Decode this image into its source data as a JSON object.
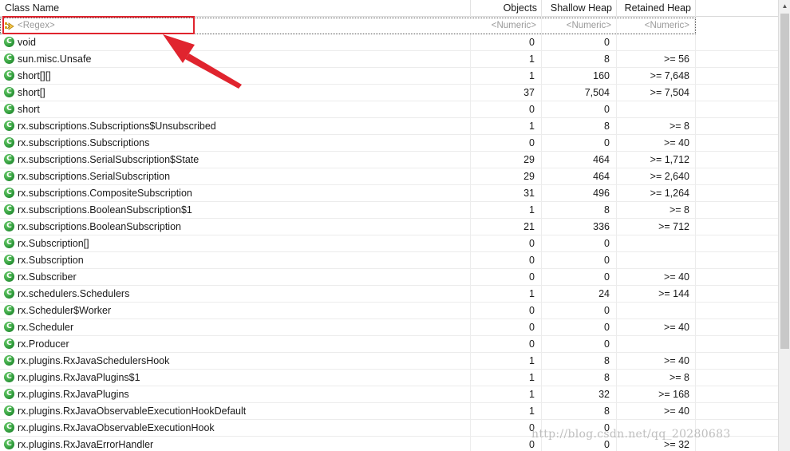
{
  "columns": {
    "class_name": "Class Name",
    "objects": "Objects",
    "shallow_heap": "Shallow Heap",
    "retained_heap": "Retained Heap"
  },
  "filter": {
    "class_name": "<Regex>",
    "objects": "<Numeric>",
    "shallow_heap": "<Numeric>",
    "retained_heap": "<Numeric>"
  },
  "rows": [
    {
      "name": "void",
      "objects": "0",
      "shallow": "0",
      "retained": ""
    },
    {
      "name": "sun.misc.Unsafe",
      "objects": "1",
      "shallow": "8",
      "retained": ">= 56"
    },
    {
      "name": "short[][]",
      "objects": "1",
      "shallow": "160",
      "retained": ">= 7,648"
    },
    {
      "name": "short[]",
      "objects": "37",
      "shallow": "7,504",
      "retained": ">= 7,504"
    },
    {
      "name": "short",
      "objects": "0",
      "shallow": "0",
      "retained": ""
    },
    {
      "name": "rx.subscriptions.Subscriptions$Unsubscribed",
      "objects": "1",
      "shallow": "8",
      "retained": ">= 8"
    },
    {
      "name": "rx.subscriptions.Subscriptions",
      "objects": "0",
      "shallow": "0",
      "retained": ">= 40"
    },
    {
      "name": "rx.subscriptions.SerialSubscription$State",
      "objects": "29",
      "shallow": "464",
      "retained": ">= 1,712"
    },
    {
      "name": "rx.subscriptions.SerialSubscription",
      "objects": "29",
      "shallow": "464",
      "retained": ">= 2,640"
    },
    {
      "name": "rx.subscriptions.CompositeSubscription",
      "objects": "31",
      "shallow": "496",
      "retained": ">= 1,264"
    },
    {
      "name": "rx.subscriptions.BooleanSubscription$1",
      "objects": "1",
      "shallow": "8",
      "retained": ">= 8"
    },
    {
      "name": "rx.subscriptions.BooleanSubscription",
      "objects": "21",
      "shallow": "336",
      "retained": ">= 712"
    },
    {
      "name": "rx.Subscription[]",
      "objects": "0",
      "shallow": "0",
      "retained": ""
    },
    {
      "name": "rx.Subscription",
      "objects": "0",
      "shallow": "0",
      "retained": ""
    },
    {
      "name": "rx.Subscriber",
      "objects": "0",
      "shallow": "0",
      "retained": ">= 40"
    },
    {
      "name": "rx.schedulers.Schedulers",
      "objects": "1",
      "shallow": "24",
      "retained": ">= 144"
    },
    {
      "name": "rx.Scheduler$Worker",
      "objects": "0",
      "shallow": "0",
      "retained": ""
    },
    {
      "name": "rx.Scheduler",
      "objects": "0",
      "shallow": "0",
      "retained": ">= 40"
    },
    {
      "name": "rx.Producer",
      "objects": "0",
      "shallow": "0",
      "retained": ""
    },
    {
      "name": "rx.plugins.RxJavaSchedulersHook",
      "objects": "1",
      "shallow": "8",
      "retained": ">= 40"
    },
    {
      "name": "rx.plugins.RxJavaPlugins$1",
      "objects": "1",
      "shallow": "8",
      "retained": ">= 8"
    },
    {
      "name": "rx.plugins.RxJavaPlugins",
      "objects": "1",
      "shallow": "32",
      "retained": ">= 168"
    },
    {
      "name": "rx.plugins.RxJavaObservableExecutionHookDefault",
      "objects": "1",
      "shallow": "8",
      "retained": ">= 40"
    },
    {
      "name": "rx.plugins.RxJavaObservableExecutionHook",
      "objects": "0",
      "shallow": "0",
      "retained": ""
    },
    {
      "name": "rx.plugins.RxJavaErrorHandler",
      "objects": "0",
      "shallow": "0",
      "retained": ">= 32"
    }
  ],
  "watermark": "http://blog.csdn.net/qq_20280683",
  "icons": {
    "class_row": "class-c-icon",
    "filter": "regex-filter-icon"
  },
  "colors": {
    "class_icon": "#2f9b3b",
    "highlight": "#e0242e",
    "placeholder": "#9a9a9a"
  }
}
